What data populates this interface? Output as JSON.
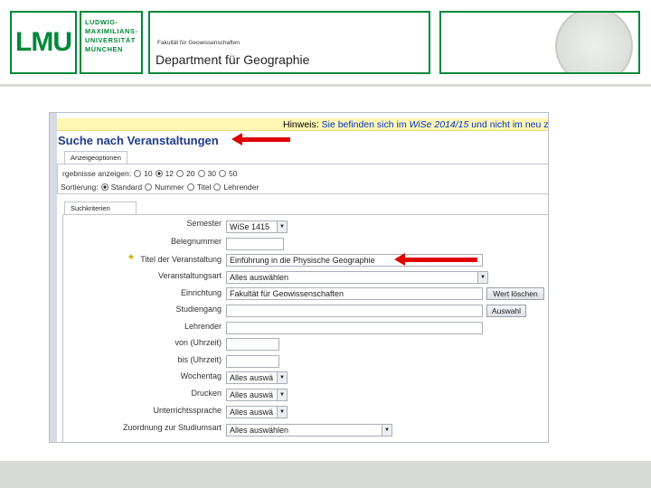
{
  "header": {
    "logo_lmu": "LMU",
    "logo_name_lines": [
      "LUDWIG-",
      "MAXIMILIANS-",
      "UNIVERSITÄT",
      "MÜNCHEN"
    ],
    "faculty": "Fakultät für Geowissenschaften",
    "department": "Department für Geographie"
  },
  "screenshot": {
    "hint_prefix": "Hinweis: ",
    "hint_text": "Sie befinden sich im ",
    "hint_semester": "WiSe 2014/15",
    "hint_suffix": " und nicht im neu zu",
    "title": "Suche nach Veranstaltungen",
    "display_options": {
      "tab_label": "Anzeigeoptionen",
      "results_label": "rgebnisse anzeigen:",
      "results_options": [
        "10",
        "12",
        "20",
        "30",
        "50"
      ],
      "results_selected": "12",
      "sort_label": "Sortierung:",
      "sort_options": [
        "Standard",
        "Nummer",
        "Titel",
        "Lehrender"
      ],
      "sort_selected": "Standard"
    },
    "criteria": {
      "tab_label": "Suchkriterien",
      "fields": [
        {
          "label": "Semester",
          "value": "WiSe 1415",
          "kind": "select"
        },
        {
          "label": "Belegnummer",
          "value": "",
          "kind": "input"
        },
        {
          "label": "Titel der Veranstaltung",
          "value": "Einführung in die Physische Geographie",
          "kind": "input"
        },
        {
          "label": "Veranstaltungsart",
          "value": "Alles auswählen",
          "kind": "select"
        },
        {
          "label": "Einrichtung",
          "value": "Fakultät für Geowissenschaften",
          "kind": "input"
        },
        {
          "label": "Studiengang",
          "value": "",
          "kind": "input"
        },
        {
          "label": "Lehrender",
          "value": "",
          "kind": "input"
        },
        {
          "label": "von (Uhrzeit)",
          "value": "",
          "kind": "input"
        },
        {
          "label": "bis (Uhrzeit)",
          "value": "",
          "kind": "input"
        },
        {
          "label": "Wochentag",
          "value": "Alles auswä",
          "kind": "select"
        },
        {
          "label": "Drucken",
          "value": "Alles auswä",
          "kind": "select"
        },
        {
          "label": "Unterrichtssprache",
          "value": "Alles auswä",
          "kind": "select"
        },
        {
          "label": "Zuordnung zur Studiumsart",
          "value": "Alles auswählen",
          "kind": "select"
        }
      ],
      "clear_button": "Wert löschen",
      "select_button": "Auswahl"
    }
  },
  "colors": {
    "lmu_green": "#00883a",
    "arrow_red": "#e00000",
    "title_blue": "#1e3a8a",
    "hint_bg": "#fff7b3"
  }
}
